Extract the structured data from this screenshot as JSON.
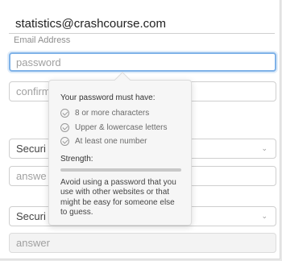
{
  "email": {
    "value": "statistics@crashcourse.com",
    "label": "Email Address"
  },
  "password": {
    "placeholder": "password"
  },
  "confirm": {
    "placeholder": "confirm"
  },
  "security_question_1": {
    "label": "Securi",
    "chevron": "chevron-down-icon"
  },
  "answer_1": {
    "placeholder": "answe"
  },
  "security_question_2": {
    "label": "Securi",
    "chevron": "chevron-down-icon"
  },
  "answer_2": {
    "placeholder": "answer"
  },
  "tooltip": {
    "heading": "Your password must have:",
    "requirements": [
      {
        "text": "8 or more characters",
        "icon": "check-circle-icon"
      },
      {
        "text": "Upper & lowercase letters",
        "icon": "check-circle-icon"
      },
      {
        "text": "At least one number",
        "icon": "check-circle-icon"
      }
    ],
    "strength_label": "Strength:",
    "advice": "Avoid using a password that you use with other websites or that might be easy for someone else to guess."
  },
  "colors": {
    "focus_border": "#7fb2e8",
    "tooltip_bg": "#f6f6f6"
  }
}
